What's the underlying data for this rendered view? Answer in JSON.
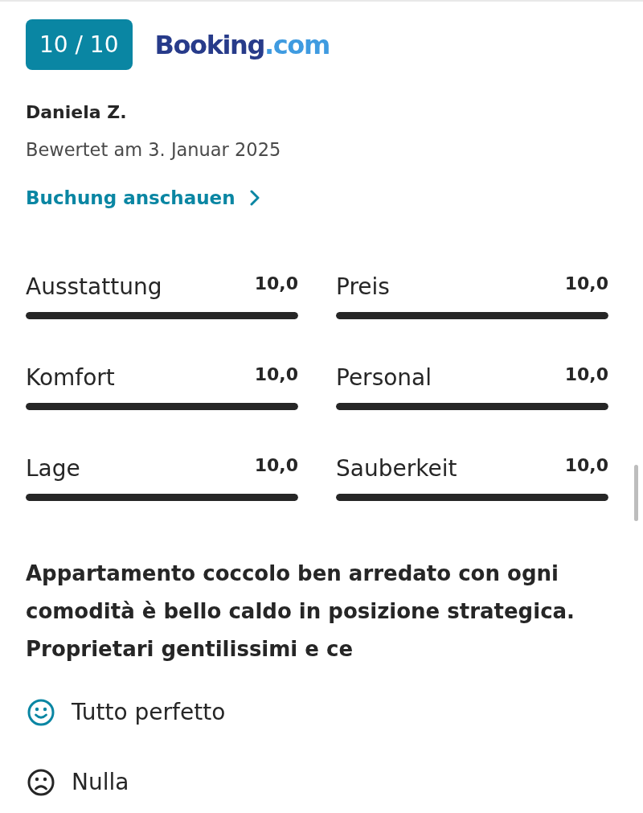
{
  "score_badge": "10 / 10",
  "source_logo": {
    "wordmark": "Booking",
    "suffix": ".com"
  },
  "reviewer": {
    "name": "Daniela Z.",
    "date": "Bewertet am 3. Januar 2025"
  },
  "booking_link": "Buchung anschauen",
  "ratings": [
    {
      "label": "Ausstattung",
      "value": "10,0",
      "level": 1
    },
    {
      "label": "Preis",
      "value": "10,0",
      "level": 1
    },
    {
      "label": "Komfort",
      "value": "10,0",
      "level": 1
    },
    {
      "label": "Personal",
      "value": "10,0",
      "level": 1
    },
    {
      "label": "Lage",
      "value": "10,0",
      "level": 1
    },
    {
      "label": "Sauberkeit",
      "value": "10,0",
      "level": 1
    }
  ],
  "review_title": "Appartamento coccolo ben arredato con ogni comodità è bello caldo in posizione strategica. Proprietari gentilissimi e ce",
  "comments": [
    {
      "kind": "positive",
      "text": "Tutto perfetto"
    },
    {
      "kind": "negative",
      "text": "Nulla"
    }
  ]
}
